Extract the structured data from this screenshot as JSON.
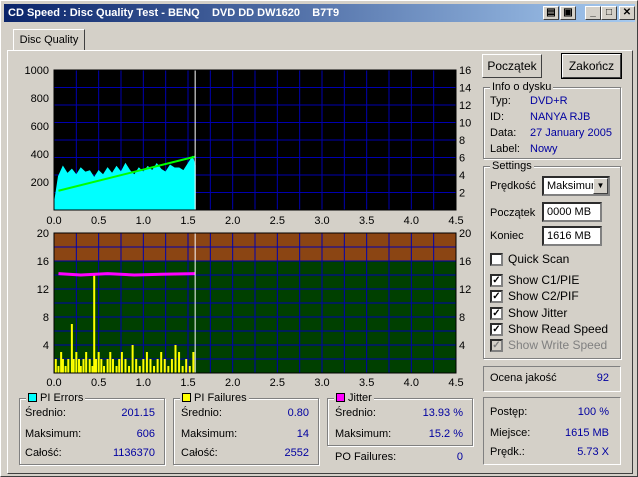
{
  "window": {
    "title": "CD Speed : Disc Quality Test - BENQ    DVD DD DW1620    B7T9",
    "controls": {
      "icon_a": "▤",
      "icon_b": "▣",
      "min": "_",
      "max": "□",
      "close": "✕"
    }
  },
  "tabs": [
    {
      "label": "Disc Quality"
    }
  ],
  "buttons": {
    "start": "Początek",
    "stop": "Zakończ"
  },
  "disc_info": {
    "title": "Info o dysku",
    "rows": [
      {
        "label": "Typ:",
        "value": "DVD+R"
      },
      {
        "label": "ID:",
        "value": "NANYA RJB"
      },
      {
        "label": "Data:",
        "value": "27 January 2005"
      },
      {
        "label": "Label:",
        "value": "Nowy"
      }
    ]
  },
  "settings": {
    "title": "Settings",
    "speed_label": "Prędkość",
    "speed_value": "Maksimum",
    "start_label": "Początek",
    "start_value": "0000 MB",
    "end_label": "Koniec",
    "end_value": "1616 MB",
    "checks": [
      {
        "label": "Quick Scan",
        "checked": false,
        "disabled": false
      },
      {
        "label": "Show C1/PIE",
        "checked": true,
        "disabled": false
      },
      {
        "label": "Show C2/PIF",
        "checked": true,
        "disabled": false
      },
      {
        "label": "Show Jitter",
        "checked": true,
        "disabled": false
      },
      {
        "label": "Show Read Speed",
        "checked": true,
        "disabled": false
      },
      {
        "label": "Show Write Speed",
        "checked": true,
        "disabled": true
      }
    ]
  },
  "quality": {
    "label": "Ocena jakość",
    "value": "92"
  },
  "progress": {
    "rows": [
      {
        "label": "Postęp:",
        "value": "100 %"
      },
      {
        "label": "Miejsce:",
        "value": "1615 MB"
      },
      {
        "label": "Prędk.:",
        "value": "5.73 X"
      }
    ]
  },
  "stats": {
    "pi_errors": {
      "title": "PI Errors",
      "color": "#00ffff",
      "rows": [
        {
          "label": "Średnio:",
          "value": "201.15"
        },
        {
          "label": "Maksimum:",
          "value": "606"
        },
        {
          "label": "Całość:",
          "value": "1136370"
        }
      ]
    },
    "pi_failures": {
      "title": "PI Failures",
      "color": "#ffff00",
      "rows": [
        {
          "label": "Średnio:",
          "value": "0.80"
        },
        {
          "label": "Maksimum:",
          "value": "14"
        },
        {
          "label": "Całość:",
          "value": "2552"
        }
      ]
    },
    "jitter": {
      "title": "Jitter",
      "color": "#ff00ff",
      "rows": [
        {
          "label": "Średnio:",
          "value": "13.93 %"
        },
        {
          "label": "Maksimum:",
          "value": "15.2 %"
        }
      ]
    },
    "po_failures": {
      "label": "PO Failures:",
      "value": "0"
    }
  },
  "chart_data": [
    {
      "type": "area",
      "name": "PI Errors chart",
      "x_ticks": [
        "0.0",
        "0.5",
        "1.0",
        "1.5",
        "2.0",
        "2.5",
        "3.0",
        "3.5",
        "4.0",
        "4.5"
      ],
      "y_left_ticks": [
        "1000",
        "800",
        "600",
        "400",
        "200"
      ],
      "y_right_ticks": [
        "16",
        "14",
        "12",
        "10",
        "8",
        "6",
        "4",
        "2"
      ],
      "xlim": [
        0,
        4.5
      ],
      "ylim": [
        0,
        1000
      ],
      "y2lim": [
        0,
        16
      ],
      "current_position": 1.58,
      "colors": {
        "background": "#000000",
        "grid": "#0000b0",
        "pi_errors": "#00ffff",
        "read_speed": "#00ff00"
      },
      "series": [
        {
          "color": "#00ffff",
          "x": [
            0.0,
            0.05,
            0.1,
            0.15,
            0.2,
            0.25,
            0.3,
            0.35,
            0.4,
            0.45,
            0.5,
            0.55,
            0.6,
            0.65,
            0.7,
            0.75,
            0.8,
            0.85,
            0.9,
            0.95,
            1.0,
            1.05,
            1.1,
            1.15,
            1.2,
            1.25,
            1.3,
            1.35,
            1.4,
            1.45,
            1.5,
            1.55,
            1.58
          ],
          "values": [
            30,
            240,
            310,
            260,
            290,
            250,
            300,
            270,
            280,
            230,
            280,
            250,
            300,
            260,
            310,
            270,
            330,
            280,
            250,
            300,
            270,
            310,
            280,
            330,
            290,
            270,
            320,
            300,
            300,
            280,
            330,
            380,
            320
          ]
        },
        {
          "color": "#00ff00",
          "x": [
            0.05,
            1.58
          ],
          "values": [
            2.2,
            6.1
          ]
        }
      ]
    },
    {
      "type": "bar",
      "name": "PI Failures / Jitter chart",
      "x_ticks": [
        "0.0",
        "0.5",
        "1.0",
        "1.5",
        "2.0",
        "2.5",
        "3.0",
        "3.5",
        "4.0",
        "4.5"
      ],
      "y_left_ticks": [
        "20",
        "16",
        "12",
        "8",
        "4"
      ],
      "y_right_ticks": [
        "20",
        "16",
        "12",
        "8",
        "4"
      ],
      "xlim": [
        0,
        4.5
      ],
      "ylim": [
        0,
        20
      ],
      "current_position": 1.58,
      "colors": {
        "upper_band": "#8b4513",
        "lower_band": "#004000",
        "grid": "#0000b0",
        "pi_failures": "#ffff00",
        "jitter": "#ff00ff"
      },
      "series": [
        {
          "color": "#ffff00",
          "x": [
            0.02,
            0.05,
            0.08,
            0.1,
            0.13,
            0.16,
            0.2,
            0.22,
            0.25,
            0.28,
            0.3,
            0.33,
            0.36,
            0.4,
            0.43,
            0.45,
            0.47,
            0.5,
            0.53,
            0.56,
            0.6,
            0.63,
            0.66,
            0.7,
            0.73,
            0.76,
            0.8,
            0.84,
            0.88,
            0.92,
            0.96,
            1.0,
            1.04,
            1.08,
            1.12,
            1.16,
            1.2,
            1.24,
            1.28,
            1.32,
            1.36,
            1.4,
            1.44,
            1.48,
            1.52,
            1.56
          ],
          "values": [
            2,
            1,
            3,
            2,
            1,
            2,
            7,
            2,
            3,
            2,
            1,
            2,
            3,
            2,
            1,
            14,
            2,
            3,
            2,
            1,
            2,
            3,
            2,
            1,
            2,
            3,
            2,
            1,
            4,
            2,
            1,
            2,
            3,
            2,
            1,
            2,
            3,
            2,
            1,
            2,
            4,
            3,
            1,
            2,
            1,
            3
          ]
        },
        {
          "color": "#ff00ff",
          "x": [
            0.05,
            0.3,
            0.6,
            0.9,
            1.2,
            1.58
          ],
          "values": [
            14.2,
            14.0,
            14.2,
            14.0,
            14.1,
            14.2
          ]
        }
      ]
    }
  ]
}
